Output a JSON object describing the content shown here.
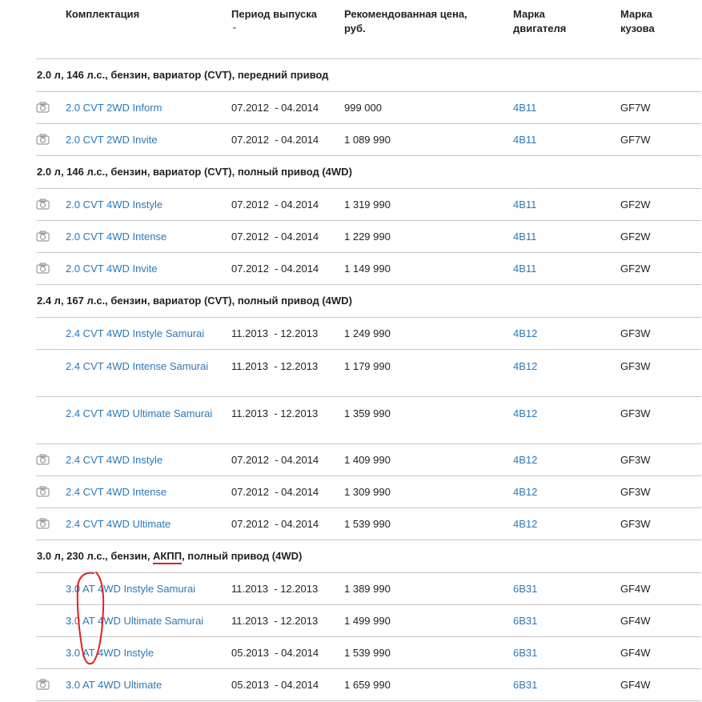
{
  "header": {
    "col1": "Комплектация",
    "col2": "Период выпуска",
    "col2_sort": "⌄",
    "col3": "Рекомендованная цена, руб.",
    "col4": "Марка двигателя",
    "col5": "Марка кузова"
  },
  "groups": [
    {
      "title": "2.0 л, 146 л.с., бензин, вариатор (CVT), передний привод",
      "rows": [
        {
          "name": "2.0 CVT 2WD Inform",
          "period": "07.2012  - 04.2014",
          "price": "999 000",
          "engine": "4B11",
          "body": "GF7W",
          "camera": true
        },
        {
          "name": "2.0 CVT 2WD Invite",
          "period": "07.2012  - 04.2014",
          "price": "1 089 990",
          "engine": "4B11",
          "body": "GF7W",
          "camera": true
        }
      ]
    },
    {
      "title": "2.0 л, 146 л.с., бензин, вариатор (CVT), полный привод (4WD)",
      "rows": [
        {
          "name": "2.0 CVT 4WD Instyle",
          "period": "07.2012  - 04.2014",
          "price": "1 319 990",
          "engine": "4B11",
          "body": "GF2W",
          "camera": true
        },
        {
          "name": "2.0 CVT 4WD Intense",
          "period": "07.2012  - 04.2014",
          "price": "1 229 990",
          "engine": "4B11",
          "body": "GF2W",
          "camera": true
        },
        {
          "name": "2.0 CVT 4WD Invite",
          "period": "07.2012  - 04.2014",
          "price": "1 149 990",
          "engine": "4B11",
          "body": "GF2W",
          "camera": true
        }
      ]
    },
    {
      "title": "2.4 л, 167 л.с., бензин, вариатор (CVT), полный привод (4WD)",
      "rows": [
        {
          "name": "2.4 CVT 4WD Instyle Samurai",
          "period": "11.2013  - 12.2013",
          "price": "1 249 990",
          "engine": "4B12",
          "body": "GF3W",
          "camera": false
        },
        {
          "name": "2.4 CVT 4WD Intense Samurai",
          "period": "11.2013  - 12.2013",
          "price": "1 179 990",
          "engine": "4B12",
          "body": "GF3W",
          "camera": false
        },
        {
          "name": "2.4 CVT 4WD Ultimate Samurai",
          "period": "11.2013  - 12.2013",
          "price": "1 359 990",
          "engine": "4B12",
          "body": "GF3W",
          "camera": false
        },
        {
          "name": "2.4 CVT 4WD Instyle",
          "period": "07.2012  - 04.2014",
          "price": "1 409 990",
          "engine": "4B12",
          "body": "GF3W",
          "camera": true
        },
        {
          "name": "2.4 CVT 4WD Intense",
          "period": "07.2012  - 04.2014",
          "price": "1 309 990",
          "engine": "4B12",
          "body": "GF3W",
          "camera": true
        },
        {
          "name": "2.4 CVT 4WD Ultimate",
          "period": "07.2012  - 04.2014",
          "price": "1 539 990",
          "engine": "4B12",
          "body": "GF3W",
          "camera": true
        }
      ]
    },
    {
      "title_pre": "3.0 л, 230 л.с., бензин, ",
      "title_mark": "АКПП",
      "title_post": ", полный привод (4WD)",
      "rows": [
        {
          "name": "3.0 AT 4WD Instyle Samurai",
          "period": "11.2013  - 12.2013",
          "price": "1 389 990",
          "engine": "6B31",
          "body": "GF4W",
          "camera": false
        },
        {
          "name": "3.0 AT 4WD Ultimate Samurai",
          "period": "11.2013  - 12.2013",
          "price": "1 499 990",
          "engine": "6B31",
          "body": "GF4W",
          "camera": false
        },
        {
          "name": "3.0 AT 4WD Instyle",
          "period": "05.2013  - 04.2014",
          "price": "1 539 990",
          "engine": "6B31",
          "body": "GF4W",
          "camera": false
        },
        {
          "name": "3.0 AT 4WD Ultimate",
          "period": "05.2013  - 04.2014",
          "price": "1 659 990",
          "engine": "6B31",
          "body": "GF4W",
          "camera": true
        }
      ]
    }
  ],
  "colors": {
    "link": "#2b78b8",
    "divider": "#c8c8c8",
    "annotation": "#e02020"
  },
  "icons": {
    "camera": "camera-icon"
  }
}
